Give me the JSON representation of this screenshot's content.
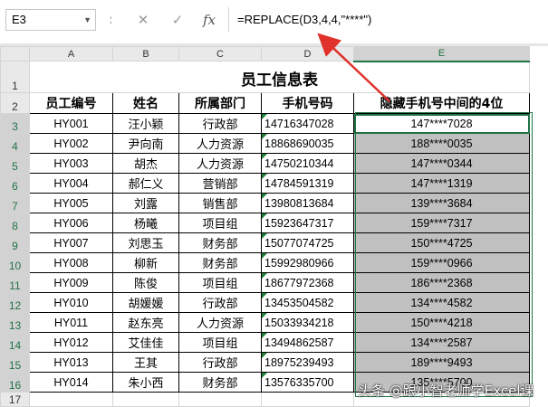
{
  "formula_bar": {
    "name_box": "E3",
    "separator": ":",
    "cancel_icon": "✕",
    "enter_icon": "✓",
    "fx_label": "fx",
    "formula": "=REPLACE(D3,4,4,\"****\")"
  },
  "columns": [
    "A",
    "B",
    "C",
    "D",
    "E"
  ],
  "rows": [
    "1",
    "2",
    "3",
    "4",
    "5",
    "6",
    "7",
    "8",
    "9",
    "10",
    "11",
    "12",
    "13",
    "14",
    "15",
    "16",
    "17"
  ],
  "sheet": {
    "title": "员工信息表",
    "headers": [
      "员工编号",
      "姓名",
      "所属部门",
      "手机号码",
      "隐藏手机号中间的4位"
    ],
    "records": [
      {
        "id": "HY001",
        "name": "汪小颖",
        "dept": "行政部",
        "phone": "14716347028",
        "masked": "147****7028"
      },
      {
        "id": "HY002",
        "name": "尹向南",
        "dept": "人力资源",
        "phone": "18868690035",
        "masked": "188****0035"
      },
      {
        "id": "HY003",
        "name": "胡杰",
        "dept": "人力资源",
        "phone": "14750210344",
        "masked": "147****0344"
      },
      {
        "id": "HY004",
        "name": "郝仁义",
        "dept": "营销部",
        "phone": "14784591319",
        "masked": "147****1319"
      },
      {
        "id": "HY005",
        "name": "刘露",
        "dept": "销售部",
        "phone": "13980813684",
        "masked": "139****3684"
      },
      {
        "id": "HY006",
        "name": "杨曦",
        "dept": "项目组",
        "phone": "15923647317",
        "masked": "159****7317"
      },
      {
        "id": "HY007",
        "name": "刘思玉",
        "dept": "财务部",
        "phone": "15077074725",
        "masked": "150****4725"
      },
      {
        "id": "HY008",
        "name": "柳新",
        "dept": "财务部",
        "phone": "15992980966",
        "masked": "159****0966"
      },
      {
        "id": "HY009",
        "name": "陈俊",
        "dept": "项目组",
        "phone": "18677972368",
        "masked": "186****2368"
      },
      {
        "id": "HY010",
        "name": "胡媛媛",
        "dept": "行政部",
        "phone": "13453504582",
        "masked": "134****4582"
      },
      {
        "id": "HY011",
        "name": "赵东亮",
        "dept": "人力资源",
        "phone": "15033934218",
        "masked": "150****4218"
      },
      {
        "id": "HY012",
        "name": "艾佳佳",
        "dept": "项目组",
        "phone": "13494862587",
        "masked": "134****2587"
      },
      {
        "id": "HY013",
        "name": "王其",
        "dept": "行政部",
        "phone": "18975239493",
        "masked": "189****9493"
      },
      {
        "id": "HY014",
        "name": "朱小西",
        "dept": "财务部",
        "phone": "13576335700",
        "masked": "135****5700"
      }
    ]
  },
  "watermark": "头条 @跟小智老师学Excel课",
  "colors": {
    "accent": "#217346",
    "arrow": "#e0312a",
    "fill": "#c0c0c0"
  }
}
